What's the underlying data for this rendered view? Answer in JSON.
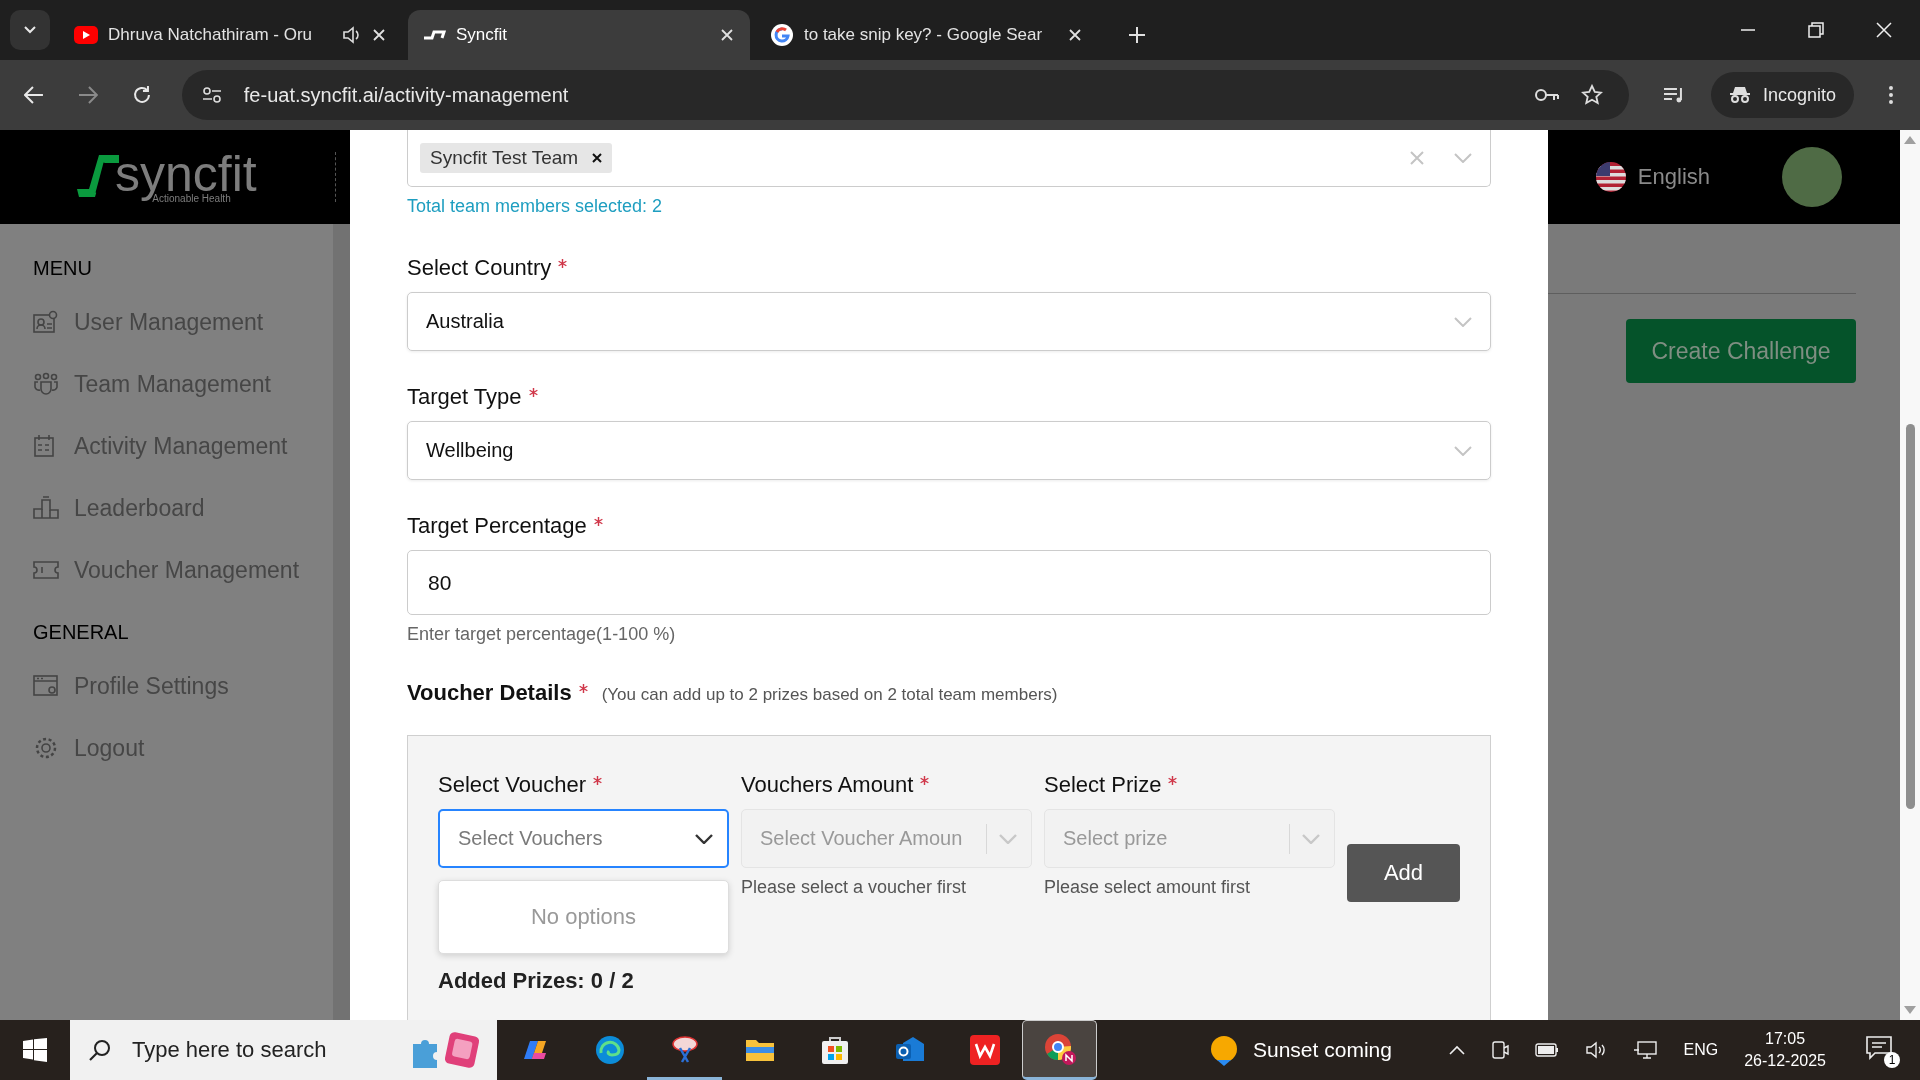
{
  "browser": {
    "tabs": [
      {
        "title": "Dhruva Natchathiram - Oru",
        "kind": "youtube",
        "audio": true,
        "selected": false
      },
      {
        "title": "Syncfit",
        "kind": "site",
        "audio": false,
        "selected": true
      },
      {
        "title": "to take snip key? - Google Sear",
        "kind": "google",
        "audio": false,
        "selected": false
      }
    ],
    "url": "fe-uat.syncfit.ai/activity-management",
    "profile": "Incognito"
  },
  "header": {
    "logo": "syncfit",
    "tagline": "Actionable Health",
    "language": "English"
  },
  "sidebar": {
    "sections": [
      {
        "title": "MENU",
        "items": [
          {
            "label": "User Management",
            "kind": "user"
          },
          {
            "label": "Team Management",
            "kind": "team"
          },
          {
            "label": "Activity Management",
            "kind": "calendar"
          },
          {
            "label": "Leaderboard",
            "kind": "podium"
          },
          {
            "label": "Voucher Management",
            "kind": "ticket"
          }
        ]
      },
      {
        "title": "GENERAL",
        "items": [
          {
            "label": "Profile Settings",
            "kind": "profile"
          },
          {
            "label": "Logout",
            "kind": "gear"
          }
        ]
      }
    ]
  },
  "page": {
    "create_button": "Create Challenge"
  },
  "modal": {
    "team_select": {
      "chips": [
        "Syncfit Test Team"
      ],
      "note": "Total team members selected: 2"
    },
    "fields": [
      {
        "label": "Select Country",
        "required": true,
        "kind": "select",
        "value": "Australia"
      },
      {
        "label": "Target Type",
        "required": true,
        "kind": "select",
        "value": "Wellbeing"
      },
      {
        "label": "Target Percentage",
        "required": true,
        "kind": "input",
        "value": "80",
        "hint": "Enter target percentage(1-100 %)"
      }
    ],
    "voucher": {
      "title": "Voucher Details",
      "required": true,
      "note": "(You can add up to 2 prizes based on 2 total team members)",
      "selects": [
        {
          "label": "Select Voucher",
          "required": true,
          "placeholder": "Select Vouchers",
          "focused": true,
          "disabled": false
        },
        {
          "label": "Vouchers Amount",
          "required": true,
          "placeholder": "Select Voucher Amoun",
          "focused": false,
          "disabled": true,
          "hint": "Please select a voucher first"
        },
        {
          "label": "Select Prize",
          "required": true,
          "placeholder": "Select prize",
          "focused": false,
          "disabled": true,
          "hint": "Please select amount first"
        }
      ],
      "add_button": "Add",
      "dropdown": "No options",
      "added": "Added Prizes: 0 / 2"
    }
  },
  "taskbar": {
    "search": {
      "placeholder": "Type here to search"
    },
    "apps": [
      {
        "kind": "copilot",
        "running": false,
        "selected": false
      },
      {
        "kind": "edge",
        "running": false,
        "selected": false
      },
      {
        "kind": "snip",
        "running": true,
        "selected": false
      },
      {
        "kind": "files",
        "running": false,
        "selected": false
      },
      {
        "kind": "store",
        "running": false,
        "selected": false
      },
      {
        "kind": "outlook",
        "running": false,
        "selected": false
      },
      {
        "kind": "wps",
        "running": false,
        "selected": false
      },
      {
        "kind": "chrome",
        "running": true,
        "selected": true
      }
    ],
    "weather": "Sunset coming",
    "language": "ENG",
    "time": "17:05",
    "date": "26-12-2025",
    "notifications": "1"
  }
}
